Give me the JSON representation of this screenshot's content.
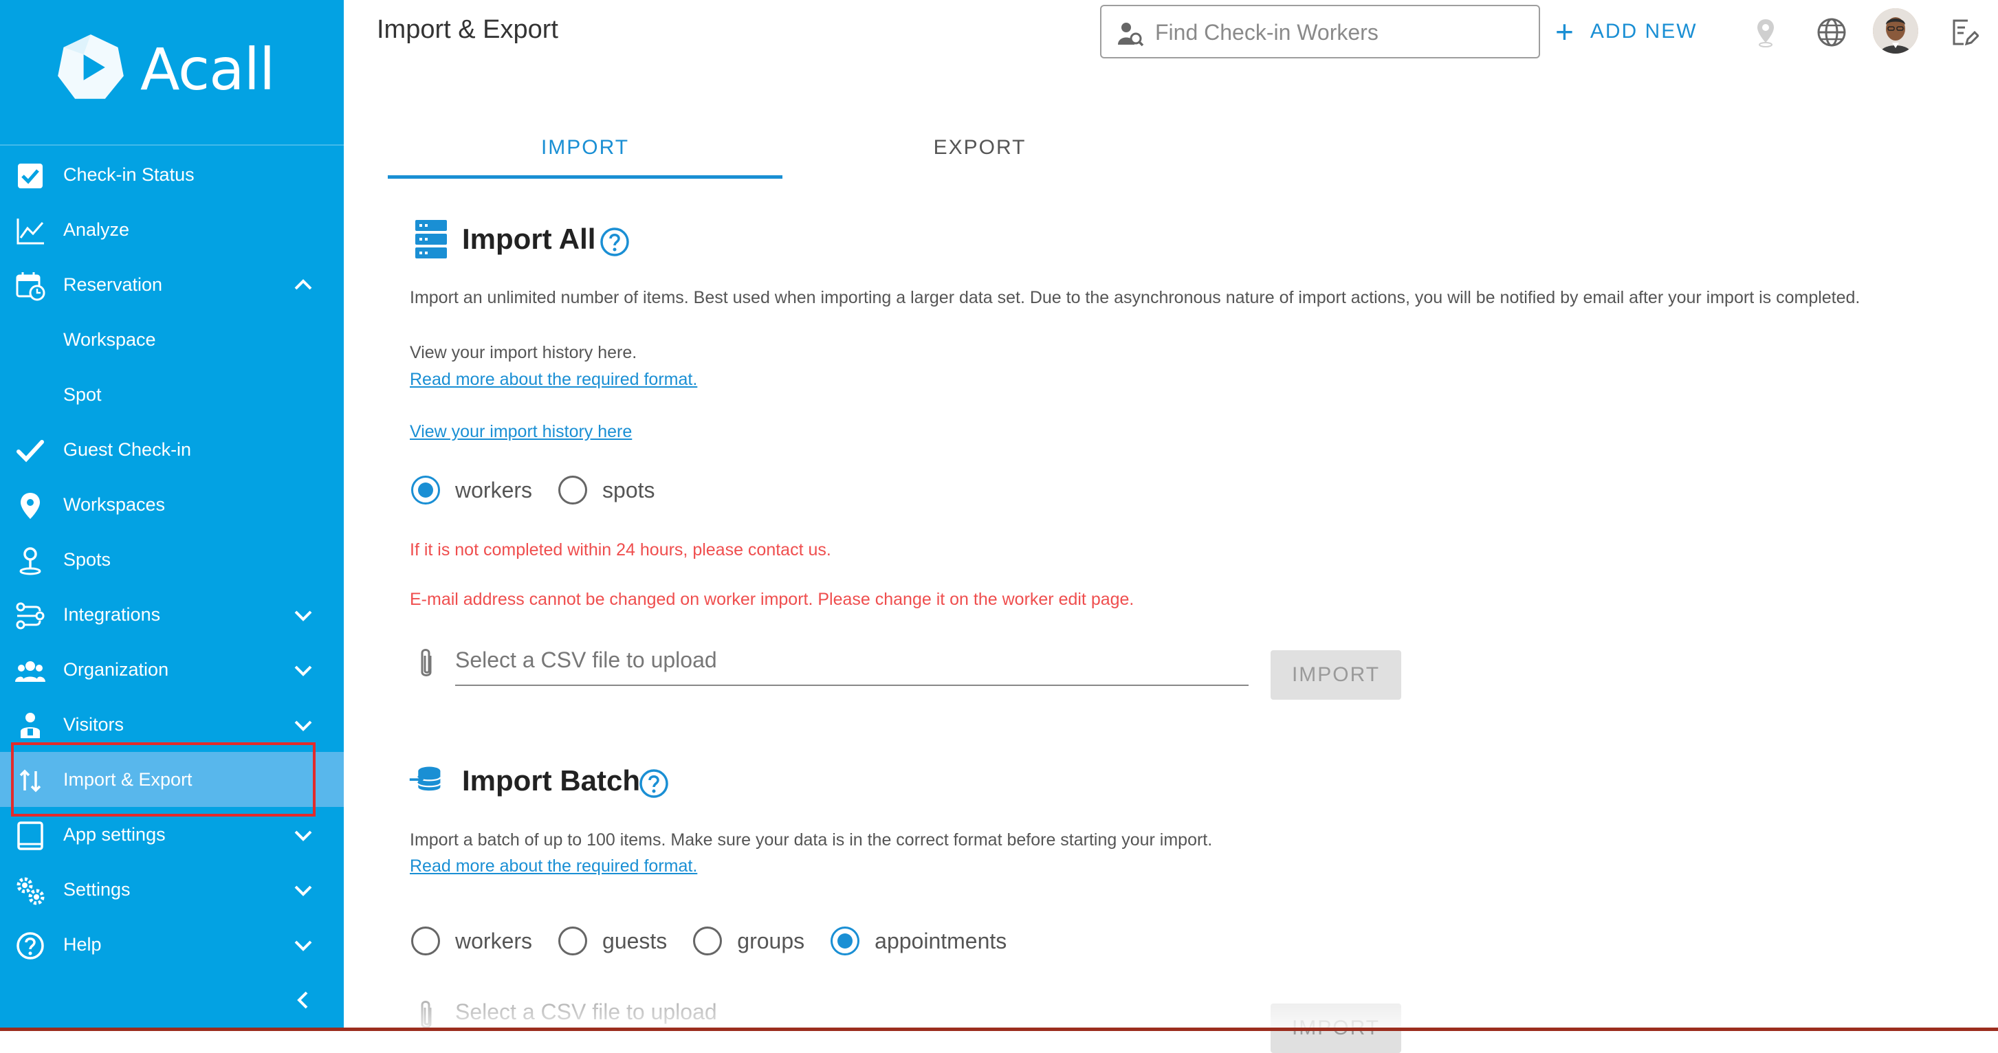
{
  "app": {
    "brand": "Acall"
  },
  "sidebar": {
    "items": [
      {
        "label": "Check-in Status",
        "icon": "checkbox-icon"
      },
      {
        "label": "Analyze",
        "icon": "line-chart-icon"
      },
      {
        "label": "Reservation",
        "icon": "calendar-clock-icon",
        "expanded": true
      },
      {
        "label": "Workspace",
        "sub": true
      },
      {
        "label": "Spot",
        "sub": true
      },
      {
        "label": "Guest Check-in",
        "icon": "checkmark-icon"
      },
      {
        "label": "Workspaces",
        "icon": "map-pin-icon"
      },
      {
        "label": "Spots",
        "icon": "person-pin-icon"
      },
      {
        "label": "Integrations",
        "icon": "integrations-icon"
      },
      {
        "label": "Organization",
        "icon": "people-icon"
      },
      {
        "label": "Visitors",
        "icon": "visitor-icon"
      },
      {
        "label": "Import & Export",
        "icon": "import-export-icon",
        "active": true
      },
      {
        "label": "App settings",
        "icon": "tablet-icon"
      },
      {
        "label": "Settings",
        "icon": "gears-icon"
      },
      {
        "label": "Help",
        "icon": "help-circle-icon"
      }
    ]
  },
  "header": {
    "title": "Import & Export",
    "search_placeholder": "Find Check-in Workers",
    "add_new_label": "ADD NEW"
  },
  "tabs": [
    {
      "label": "IMPORT",
      "active": true
    },
    {
      "label": "EXPORT",
      "active": false
    }
  ],
  "import_all": {
    "title": "Import All",
    "description": "Import an unlimited number of items. Best used when importing a larger data set. Due to the asynchronous nature of import actions, you will be notified by email after your import is completed.",
    "history_text": "View your import history here.",
    "format_link": "Read more about the required format.",
    "history_link": "View your import history here",
    "options": [
      {
        "label": "workers",
        "checked": true
      },
      {
        "label": "spots",
        "checked": false
      }
    ],
    "warning_1": "If it is not completed within 24 hours, please contact us.",
    "warning_2": "E-mail address cannot be changed on worker import. Please change it on the worker edit page.",
    "file_placeholder": "Select a CSV file to upload",
    "import_button": "IMPORT"
  },
  "import_batch": {
    "title": "Import Batch",
    "description": "Import a batch of up to 100 items. Make sure your data is in the correct format before starting your import.",
    "format_link": "Read more about the required format.",
    "options": [
      {
        "label": "workers",
        "checked": false
      },
      {
        "label": "guests",
        "checked": false
      },
      {
        "label": "groups",
        "checked": false
      },
      {
        "label": "appointments",
        "checked": true
      }
    ],
    "file_placeholder": "Select a CSV file to upload",
    "import_button": "IMPORT"
  },
  "colors": {
    "sidebar": "#03a2e3",
    "accent": "#1a8fd4",
    "warning": "#ef4e4e",
    "highlight": "#e22b2b"
  }
}
